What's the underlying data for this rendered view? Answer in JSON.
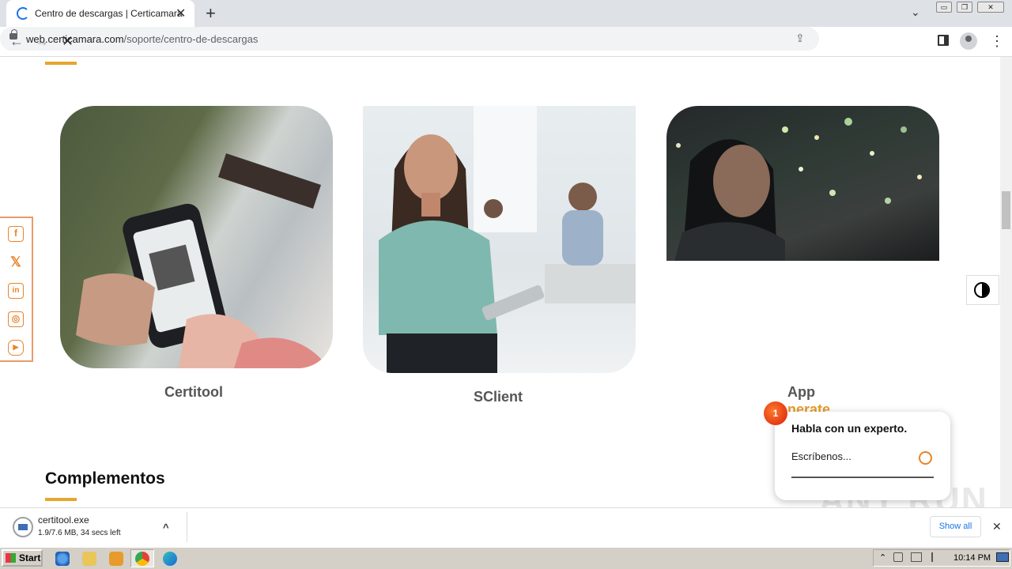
{
  "browser": {
    "tab_title": "Centro de descargas | Certicamara",
    "tab_close": "✕",
    "new_tab": "+",
    "tab_search": "⌄",
    "window_buttons": [
      "▭",
      "❐",
      "✕"
    ],
    "url_domain": "web.certicamara.com",
    "url_path": "/soporte/centro-de-descargas",
    "back": "←",
    "forward": "→",
    "stop": "✕",
    "share": "⇪",
    "star": "☆",
    "menu": "⋮"
  },
  "page": {
    "cards": [
      {
        "label": "Certitool"
      },
      {
        "label": "SClient"
      },
      {
        "label": "App",
        "label_highlight": "nerate"
      }
    ],
    "complementos_heading": "Complementos"
  },
  "social": {
    "icons": [
      "facebook-icon",
      "x-icon",
      "linkedin-icon",
      "instagram-icon",
      "youtube-icon"
    ],
    "glyphs": [
      "f",
      "𝕏",
      "in",
      "◎",
      "▶"
    ]
  },
  "chat": {
    "badge_count": "1",
    "title": "Habla con un experto.",
    "placeholder": "Escríbenos..."
  },
  "download": {
    "file_name": "certitool.exe",
    "progress_text": "1.9/7.6 MB, 34 secs left",
    "chevron": "^",
    "show_all": "Show all",
    "close": "✕"
  },
  "watermark": "ANY RUN",
  "taskbar": {
    "start": "Start",
    "clock": "10:14 PM"
  },
  "colors": {
    "accent": "#e8a52e",
    "social_orange": "#e8842b",
    "chat_badge": "#e8321a"
  }
}
